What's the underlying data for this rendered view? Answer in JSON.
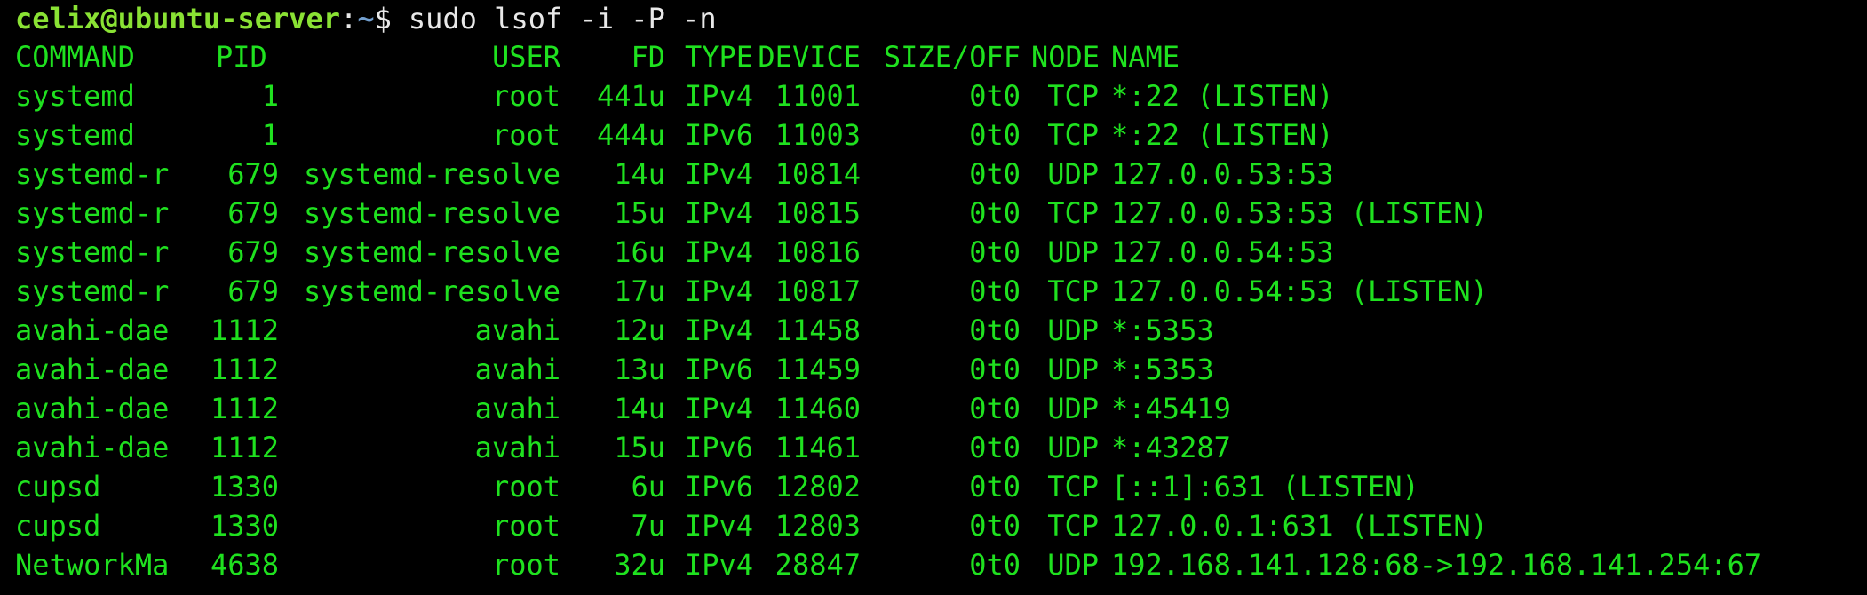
{
  "prompt": {
    "user_host": "celix@ubuntu-server",
    "colon": ":",
    "path": "~",
    "dollar": "$",
    "command": "sudo lsof -i -P -n"
  },
  "header": {
    "command": "COMMAND",
    "pid": "PID",
    "user": "USER",
    "fd": "FD",
    "type": "TYPE",
    "device": "DEVICE",
    "size": "SIZE/OFF",
    "node": "NODE",
    "name": "NAME"
  },
  "rows": [
    {
      "command": "systemd",
      "pid": "1",
      "user": "root",
      "fd": "441u",
      "type": "IPv4",
      "device": "11001",
      "size": "0t0",
      "node": "TCP",
      "name": "*:22 (LISTEN)"
    },
    {
      "command": "systemd",
      "pid": "1",
      "user": "root",
      "fd": "444u",
      "type": "IPv6",
      "device": "11003",
      "size": "0t0",
      "node": "TCP",
      "name": "*:22 (LISTEN)"
    },
    {
      "command": "systemd-r",
      "pid": "679",
      "user": "systemd-resolve",
      "fd": "14u",
      "type": "IPv4",
      "device": "10814",
      "size": "0t0",
      "node": "UDP",
      "name": "127.0.0.53:53"
    },
    {
      "command": "systemd-r",
      "pid": "679",
      "user": "systemd-resolve",
      "fd": "15u",
      "type": "IPv4",
      "device": "10815",
      "size": "0t0",
      "node": "TCP",
      "name": "127.0.0.53:53 (LISTEN)"
    },
    {
      "command": "systemd-r",
      "pid": "679",
      "user": "systemd-resolve",
      "fd": "16u",
      "type": "IPv4",
      "device": "10816",
      "size": "0t0",
      "node": "UDP",
      "name": "127.0.0.54:53"
    },
    {
      "command": "systemd-r",
      "pid": "679",
      "user": "systemd-resolve",
      "fd": "17u",
      "type": "IPv4",
      "device": "10817",
      "size": "0t0",
      "node": "TCP",
      "name": "127.0.0.54:53 (LISTEN)"
    },
    {
      "command": "avahi-dae",
      "pid": "1112",
      "user": "avahi",
      "fd": "12u",
      "type": "IPv4",
      "device": "11458",
      "size": "0t0",
      "node": "UDP",
      "name": "*:5353"
    },
    {
      "command": "avahi-dae",
      "pid": "1112",
      "user": "avahi",
      "fd": "13u",
      "type": "IPv6",
      "device": "11459",
      "size": "0t0",
      "node": "UDP",
      "name": "*:5353"
    },
    {
      "command": "avahi-dae",
      "pid": "1112",
      "user": "avahi",
      "fd": "14u",
      "type": "IPv4",
      "device": "11460",
      "size": "0t0",
      "node": "UDP",
      "name": "*:45419"
    },
    {
      "command": "avahi-dae",
      "pid": "1112",
      "user": "avahi",
      "fd": "15u",
      "type": "IPv6",
      "device": "11461",
      "size": "0t0",
      "node": "UDP",
      "name": "*:43287"
    },
    {
      "command": "cupsd",
      "pid": "1330",
      "user": "root",
      "fd": "6u",
      "type": "IPv6",
      "device": "12802",
      "size": "0t0",
      "node": "TCP",
      "name": "[::1]:631 (LISTEN)"
    },
    {
      "command": "cupsd",
      "pid": "1330",
      "user": "root",
      "fd": "7u",
      "type": "IPv4",
      "device": "12803",
      "size": "0t0",
      "node": "TCP",
      "name": "127.0.0.1:631 (LISTEN)"
    },
    {
      "command": "NetworkMa",
      "pid": "4638",
      "user": "root",
      "fd": "32u",
      "type": "IPv4",
      "device": "28847",
      "size": "0t0",
      "node": "UDP",
      "name": "192.168.141.128:68->192.168.141.254:67"
    }
  ],
  "colors": {
    "background": "#000000",
    "output_text": "#1fe11f",
    "prompt_user_host": "#8ae234",
    "prompt_path": "#729fcf",
    "command_text": "#e8e8e8"
  }
}
